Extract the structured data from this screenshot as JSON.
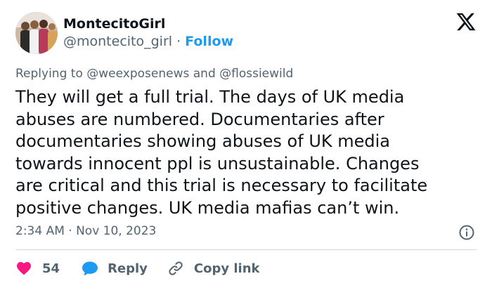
{
  "author": {
    "display_name": "MontecitoGirl",
    "handle": "@montecito_girl",
    "separator": " · ",
    "follow_label": "Follow"
  },
  "reply_context": {
    "prefix": "Replying to ",
    "mention_1": "@weexposenews",
    "conjunction": " and ",
    "mention_2": "@flossiewild"
  },
  "tweet": {
    "text": "They will get a full trial. The days of UK media\nabuses are numbered. Documentaries after\ndocumentaries showing abuses of UK media\ntowards innocent ppl is unsustainable. Changes\nare critical and this trial is necessary to facilitate\npositive changes. UK media mafias can’t win.",
    "timestamp": "2:34 AM · Nov 10, 2023"
  },
  "actions": {
    "like_count": "54",
    "reply_label": "Reply",
    "copy_link_label": "Copy link"
  },
  "icons": {
    "logo": "x-logo-icon",
    "info": "info-icon",
    "like": "heart-icon",
    "reply": "reply-bubble-icon",
    "copy_link": "link-icon"
  },
  "colors": {
    "text_primary": "#0f1419",
    "text_secondary": "#536471",
    "accent_blue": "#1d9bf0",
    "like_pink": "#f91880",
    "divider": "#cfd9de"
  }
}
